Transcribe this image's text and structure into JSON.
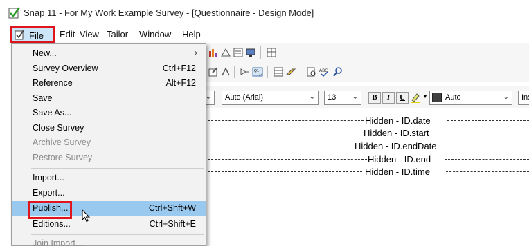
{
  "window": {
    "title": "Snap 11 - For My Work Example Survey - [Questionnaire - Design Mode]"
  },
  "menubar": {
    "items": [
      "File",
      "Edit",
      "View",
      "Tailor",
      "Window",
      "Help"
    ]
  },
  "file_menu": {
    "items": [
      {
        "label": "New...",
        "shortcut": "",
        "submenu": true,
        "enabled": true
      },
      {
        "label": "Survey Overview",
        "shortcut": "Ctrl+F12",
        "enabled": true
      },
      {
        "label": "Reference",
        "shortcut": "Alt+F12",
        "enabled": true
      },
      {
        "label": "Save",
        "shortcut": "",
        "enabled": true
      },
      {
        "label": "Save As...",
        "shortcut": "",
        "enabled": true
      },
      {
        "label": "Close Survey",
        "shortcut": "",
        "enabled": true
      },
      {
        "label": "Archive Survey",
        "shortcut": "",
        "enabled": false
      },
      {
        "label": "Restore Survey",
        "shortcut": "",
        "enabled": false
      },
      {
        "label": "Import...",
        "shortcut": "",
        "enabled": true
      },
      {
        "label": "Export...",
        "shortcut": "",
        "enabled": true
      },
      {
        "label": "Publish...",
        "shortcut": "Ctrl+Shft+W",
        "enabled": true,
        "highlighted": true
      },
      {
        "label": "Editions...",
        "shortcut": "Ctrl+Shift+E",
        "enabled": true
      },
      {
        "label": "Join Import...",
        "shortcut": "",
        "enabled": false
      }
    ]
  },
  "format_toolbar": {
    "font_name": "Auto (Arial)",
    "font_size": "13",
    "bold": "B",
    "italic": "I",
    "underline": "U",
    "text_color": "Auto",
    "insert_label": "Ins"
  },
  "editor": {
    "hidden_fields": [
      "Hidden - ID.date",
      "Hidden - ID.start",
      "Hidden - ID.endDate",
      "Hidden - ID.end",
      "Hidden - ID.time"
    ]
  },
  "colors": {
    "highlight": "#99c9ef",
    "callout_border": "#e0141c",
    "menu_background": "#f2f2f2"
  }
}
